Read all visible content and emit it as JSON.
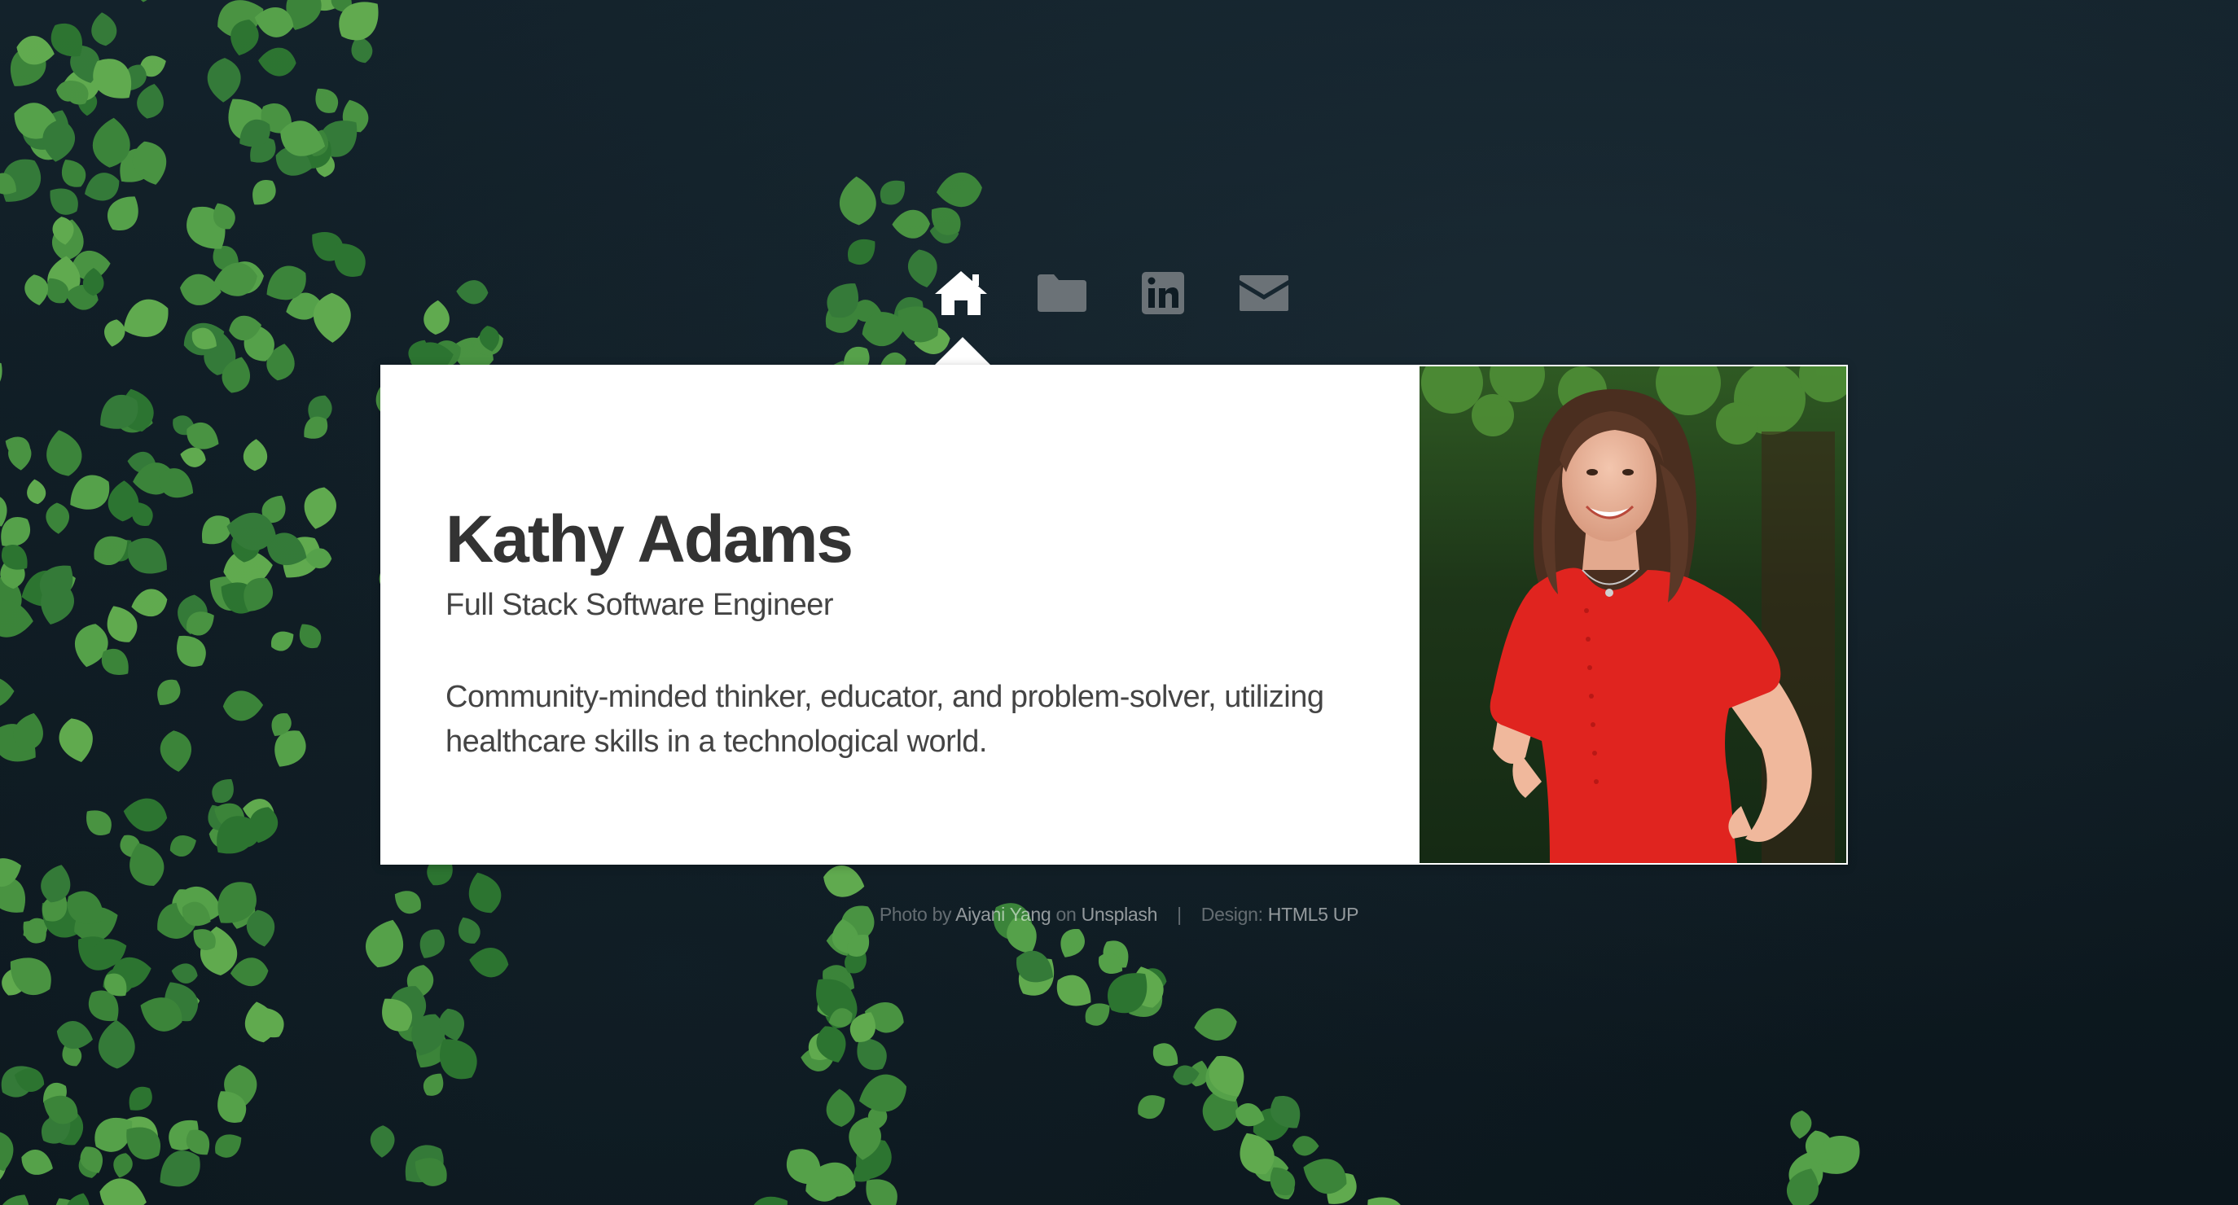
{
  "nav": {
    "items": [
      {
        "icon": "home-icon",
        "active": true
      },
      {
        "icon": "folder-icon",
        "active": false
      },
      {
        "icon": "linkedin-icon",
        "active": false
      },
      {
        "icon": "envelope-icon",
        "active": false
      }
    ]
  },
  "profile": {
    "name": "Kathy Adams",
    "title": "Full Stack Software Engineer",
    "bio": "Community-minded thinker, educator, and problem-solver, utilizing healthcare skills in a technological world."
  },
  "footer": {
    "photo_prefix": "Photo by ",
    "photographer": "Aiyani Yang",
    "on": " on ",
    "source": "Unsplash",
    "separator": "|",
    "design_prefix": "Design: ",
    "design": "HTML5 UP"
  },
  "colors": {
    "background": "#0f1c24",
    "panel": "#ffffff",
    "heading": "#333333",
    "body_text": "#444444",
    "nav_active": "#ffffff",
    "nav_inactive": "#6b7277",
    "leaf": "#3e8a3a",
    "shirt": "#e0241f"
  }
}
